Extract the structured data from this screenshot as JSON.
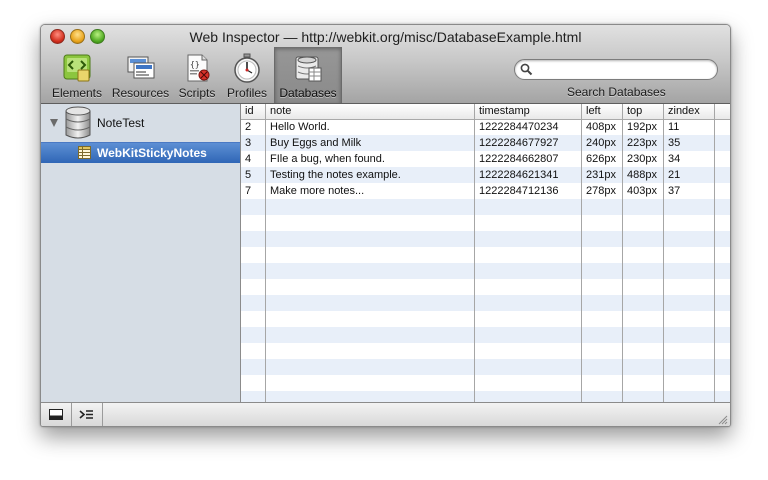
{
  "window": {
    "title": "Web Inspector — http://webkit.org/misc/DatabaseExample.html"
  },
  "toolbar": {
    "items": [
      {
        "label": "Elements",
        "icon": "elements-icon"
      },
      {
        "label": "Resources",
        "icon": "resources-icon"
      },
      {
        "label": "Scripts",
        "icon": "scripts-icon"
      },
      {
        "label": "Profiles",
        "icon": "profiles-icon"
      },
      {
        "label": "Databases",
        "icon": "databases-icon",
        "selected": true
      }
    ],
    "search": {
      "value": "",
      "placeholder": "",
      "caption": "Search Databases"
    }
  },
  "sidebar": {
    "database": {
      "name": "NoteTest",
      "expanded": true
    },
    "tables": [
      {
        "name": "WebKitStickyNotes",
        "selected": true
      }
    ]
  },
  "table": {
    "columns": [
      "id",
      "note",
      "timestamp",
      "left",
      "top",
      "zindex"
    ],
    "rows": [
      [
        "2",
        "Hello World.",
        "1222284470234",
        "408px",
        "192px",
        "11"
      ],
      [
        "3",
        "Buy Eggs and Milk",
        "1222284677927",
        "240px",
        "223px",
        "35"
      ],
      [
        "4",
        "FIle a bug, when found.",
        "1222284662807",
        "626px",
        "230px",
        "34"
      ],
      [
        "5",
        "Testing the notes example.",
        "1222284621341",
        "231px",
        "488px",
        "21"
      ],
      [
        "7",
        "Make more notes...",
        "1222284712136",
        "278px",
        "403px",
        "37"
      ]
    ]
  },
  "statusbar": {
    "buttons": [
      {
        "icon": "dock-icon"
      },
      {
        "icon": "console-icon"
      }
    ]
  },
  "colors": {
    "selection": "#3a6fc0",
    "stripe": "#e8eff9",
    "sidebar": "#d6dde5"
  }
}
